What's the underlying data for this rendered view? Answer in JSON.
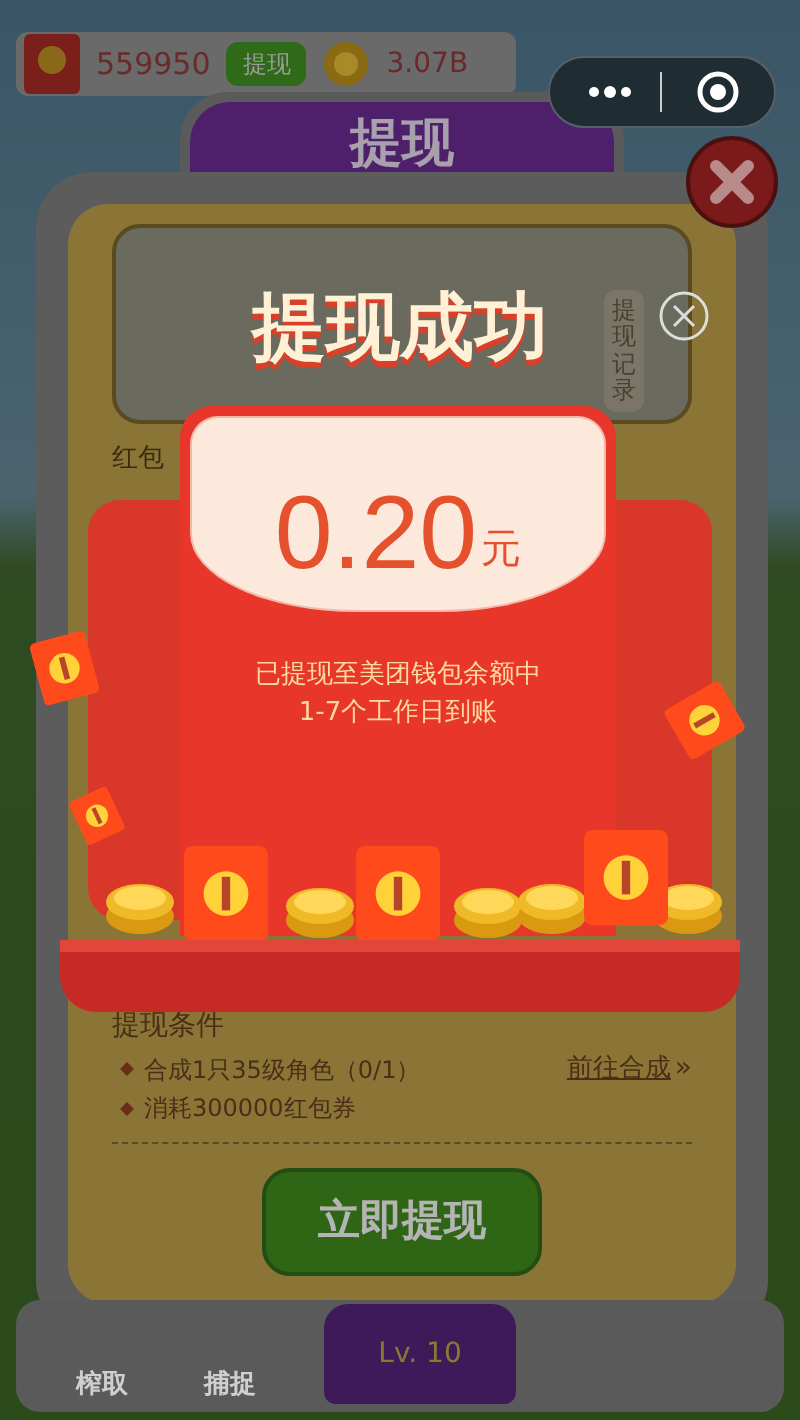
{
  "hud": {
    "red_packet_balance": "559950",
    "withdraw_button": "提现",
    "coin_balance": "3.07B"
  },
  "panel": {
    "title": "提现",
    "record_button": "提现记录",
    "section_label": "红包",
    "conditions_title": "提现条件",
    "conditions": [
      {
        "text": "合成1只35级角色（0/1）",
        "link": "前往合成",
        "link_arrow": "»"
      },
      {
        "text": "消耗300000红包券"
      }
    ],
    "submit_button": "立即提现"
  },
  "bottom_nav": [
    {
      "kind": "icon",
      "label": "榨取"
    },
    {
      "kind": "icon",
      "label": "捕捉"
    },
    {
      "kind": "level",
      "label": "Lv. 10"
    }
  ],
  "success_popup": {
    "title": "提现成功",
    "amount": "0.20",
    "unit": "元",
    "message_lines": [
      "已提现至美团钱包余额中",
      "1-7个工作日到账"
    ]
  }
}
